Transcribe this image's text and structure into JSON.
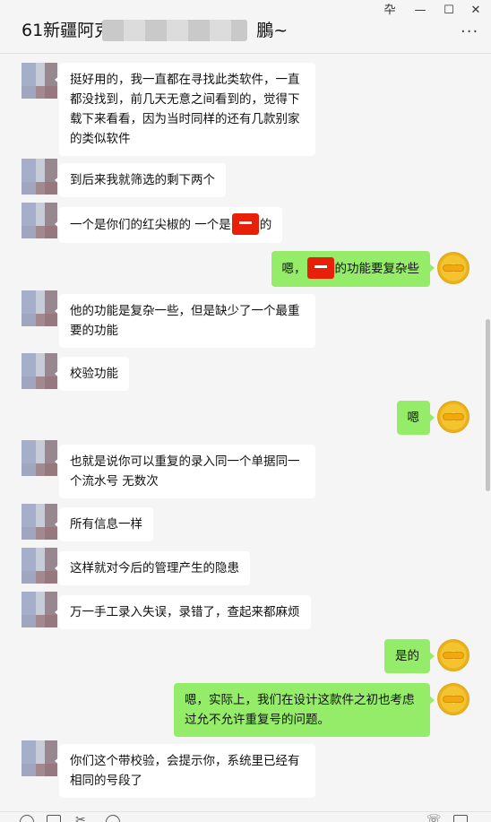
{
  "window": {
    "pin_glyph": "卆",
    "minimize_glyph": "—",
    "maximize_glyph": "☐",
    "close_glyph": "✕"
  },
  "header": {
    "title_prefix": "61新疆阿克",
    "title_suffix": "鵬~",
    "more_glyph": "···"
  },
  "messages": [
    {
      "side": "left",
      "text": "挺好用的，我一直都在寻找此类软件，一直都没找到，前几天无意之间看到的，觉得下载下来看看，因为当时同样的还有几款别家的类似软件"
    },
    {
      "side": "left",
      "text": "到后来我就筛选的剩下两个"
    },
    {
      "side": "left",
      "text_before": "一个是你们的红尖椒的  一个是",
      "text_after": "的"
    },
    {
      "side": "right",
      "text_before": "嗯，",
      "text_after": "的功能要复杂些"
    },
    {
      "side": "left",
      "text": "他的功能是复杂一些，但是缺少了一个最重要的功能"
    },
    {
      "side": "left",
      "text": "校验功能"
    },
    {
      "side": "right",
      "text": "嗯"
    },
    {
      "side": "left",
      "text": "也就是说你可以重复的录入同一个单据同一个流水号 无数次"
    },
    {
      "side": "left",
      "text": "所有信息一样"
    },
    {
      "side": "left",
      "text": "这样就对今后的管理产生的隐患"
    },
    {
      "side": "left",
      "text": "万一手工录入失误，录错了，查起来都麻烦"
    },
    {
      "side": "right",
      "text": "是的"
    },
    {
      "side": "right",
      "text": "嗯，实际上，我们在设计这款件之初也考虑过允不允许重复号的问题。"
    },
    {
      "side": "left",
      "text": "你们这个带校验，会提示你，系统里已经有相同的号段了"
    }
  ],
  "toolbar": {
    "scissor_glyph": "✂",
    "phone_glyph": "☏"
  }
}
